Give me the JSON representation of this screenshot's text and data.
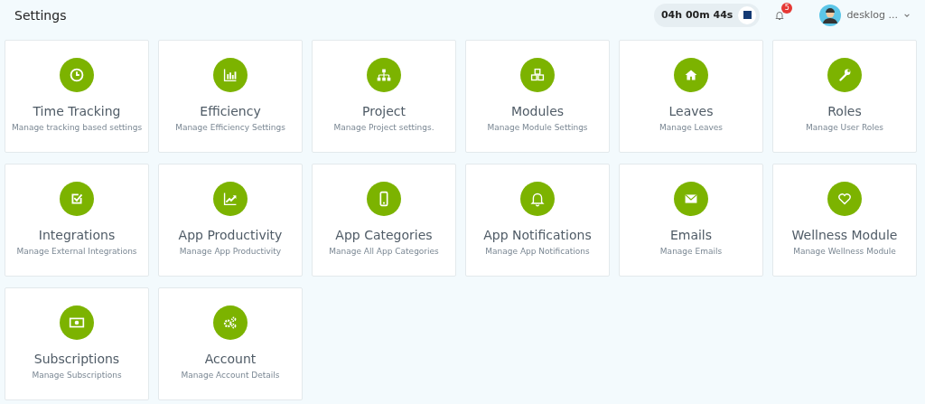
{
  "header": {
    "title": "Settings",
    "timer": "04h 00m 44s",
    "notification_count": "5",
    "user_name": "desklog ..."
  },
  "cards": [
    {
      "title": "Time Tracking",
      "description": "Manage tracking based settings"
    },
    {
      "title": "Efficiency",
      "description": "Manage Efficiency Settings"
    },
    {
      "title": "Project",
      "description": "Manage Project settings."
    },
    {
      "title": "Modules",
      "description": "Manage Module Settings"
    },
    {
      "title": "Leaves",
      "description": "Manage Leaves"
    },
    {
      "title": "Roles",
      "description": "Manage User Roles"
    },
    {
      "title": "Integrations",
      "description": "Manage External Integrations"
    },
    {
      "title": "App Productivity",
      "description": "Manage App Productivity"
    },
    {
      "title": "App Categories",
      "description": "Manage All App Categories"
    },
    {
      "title": "App Notifications",
      "description": "Manage App Notifications"
    },
    {
      "title": "Emails",
      "description": "Manage Emails"
    },
    {
      "title": "Wellness Module",
      "description": "Manage Wellness Module"
    },
    {
      "title": "Subscriptions",
      "description": "Manage Subscriptions"
    },
    {
      "title": "Account",
      "description": "Manage Account Details"
    }
  ]
}
